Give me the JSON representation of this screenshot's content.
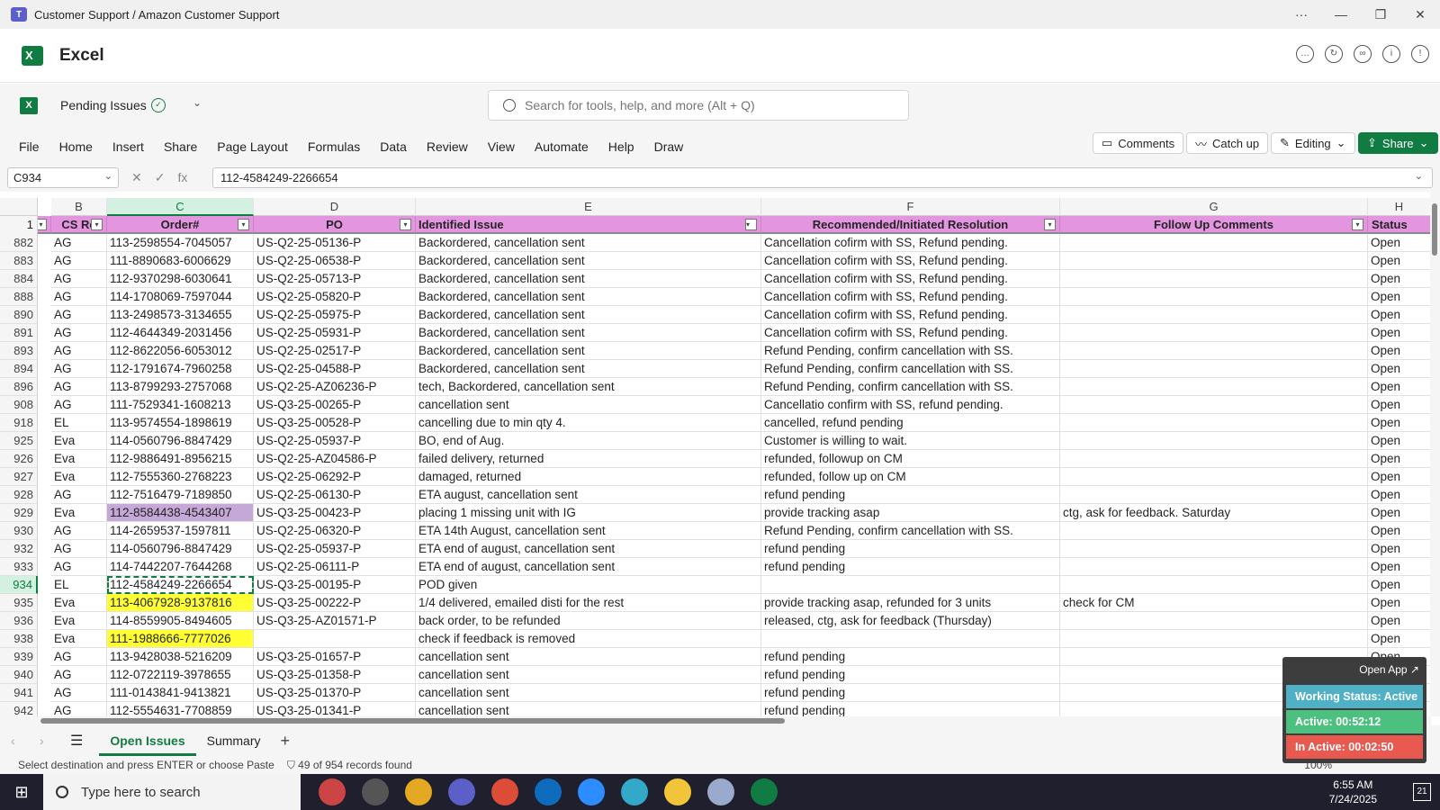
{
  "window": {
    "title": "Customer Support / Amazon Customer Support"
  },
  "app": {
    "name": "Excel"
  },
  "doc": {
    "name": "Pending Issues",
    "search_placeholder": "Search for tools, help, and more (Alt + Q)"
  },
  "ribbon": {
    "tabs": [
      "File",
      "Home",
      "Insert",
      "Share",
      "Page Layout",
      "Formulas",
      "Data",
      "Review",
      "View",
      "Automate",
      "Help",
      "Draw"
    ],
    "comments": "Comments",
    "catchup": "Catch up",
    "editing": "Editing",
    "share": "Share"
  },
  "formula": {
    "namebox": "C934",
    "value": "112-4584249-2266654"
  },
  "columns": [
    "B",
    "C",
    "D",
    "E",
    "F",
    "G",
    "H"
  ],
  "header_row_num": "1",
  "headers": [
    "CS Re",
    "Order#",
    "PO",
    "Identified Issue",
    "Recommended/Initiated Resolution",
    "Follow Up Comments",
    "Status"
  ],
  "rows": [
    {
      "n": "882",
      "b": "AG",
      "c": "113-2598554-7045057",
      "d": "US-Q2-25-05136-P",
      "e": "Backordered, cancellation sent",
      "f": "Cancellation cofirm with SS, Refund pending.",
      "g": "",
      "h": "Open"
    },
    {
      "n": "883",
      "b": "AG",
      "c": "111-8890683-6006629",
      "d": "US-Q2-25-06538-P",
      "e": "Backordered, cancellation sent",
      "f": "Cancellation cofirm with SS, Refund pending.",
      "g": "",
      "h": "Open"
    },
    {
      "n": "884",
      "b": "AG",
      "c": "112-9370298-6030641",
      "d": "US-Q2-25-05713-P",
      "e": "Backordered, cancellation sent",
      "f": "Cancellation cofirm with SS, Refund pending.",
      "g": "",
      "h": "Open"
    },
    {
      "n": "888",
      "b": "AG",
      "c": "114-1708069-7597044",
      "d": "US-Q2-25-05820-P",
      "e": "Backordered, cancellation sent",
      "f": "Cancellation cofirm with SS, Refund pending.",
      "g": "",
      "h": "Open"
    },
    {
      "n": "890",
      "b": "AG",
      "c": "113-2498573-3134655",
      "d": "US-Q2-25-05975-P",
      "e": "Backordered, cancellation sent",
      "f": "Cancellation cofirm with SS, Refund pending.",
      "g": "",
      "h": "Open"
    },
    {
      "n": "891",
      "b": "AG",
      "c": "112-4644349-2031456",
      "d": "US-Q2-25-05931-P",
      "e": "Backordered, cancellation sent",
      "f": "Cancellation cofirm with SS, Refund pending.",
      "g": "",
      "h": "Open"
    },
    {
      "n": "893",
      "b": "AG",
      "c": "112-8622056-6053012",
      "d": "US-Q2-25-02517-P",
      "e": "Backordered, cancellation sent",
      "f": "Refund Pending, confirm cancellation with SS.",
      "g": "",
      "h": "Open"
    },
    {
      "n": "894",
      "b": "AG",
      "c": "112-1791674-7960258",
      "d": "US-Q2-25-04588-P",
      "e": "Backordered, cancellation sent",
      "f": "Refund Pending, confirm cancellation with SS.",
      "g": "",
      "h": "Open"
    },
    {
      "n": "896",
      "b": "AG",
      "c": "113-8799293-2757068",
      "d": "US-Q2-25-AZ06236-P",
      "e": "tech, Backordered, cancellation sent",
      "f": "Refund Pending, confirm cancellation with SS.",
      "g": "",
      "h": "Open"
    },
    {
      "n": "908",
      "b": "AG",
      "c": "111-7529341-1608213",
      "d": "US-Q3-25-00265-P",
      "e": "cancellation sent",
      "f": "Cancellatio confirm with SS, refund pending.",
      "g": "",
      "h": "Open"
    },
    {
      "n": "918",
      "b": "EL",
      "c": "113-9574554-1898619",
      "d": "US-Q3-25-00528-P",
      "e": "cancelling due to min qty 4.",
      "f": "cancelled, refund pending",
      "g": "",
      "h": "Open"
    },
    {
      "n": "925",
      "b": "Eva",
      "c": "114-0560796-8847429",
      "d": "US-Q2-25-05937-P",
      "e": "BO, end of Aug.",
      "f": "Customer is willing to wait.",
      "g": "",
      "h": "Open"
    },
    {
      "n": "926",
      "b": "Eva",
      "c": "112-9886491-8956215",
      "d": "US-Q2-25-AZ04586-P",
      "e": "failed delivery, returned",
      "f": "refunded, followup on CM",
      "g": "",
      "h": "Open"
    },
    {
      "n": "927",
      "b": "Eva",
      "c": "112-7555360-2768223",
      "d": "US-Q2-25-06292-P",
      "e": "damaged, returned",
      "f": "refunded, follow up on CM",
      "g": "",
      "h": "Open"
    },
    {
      "n": "928",
      "b": "AG",
      "c": "112-7516479-7189850",
      "d": "US-Q2-25-06130-P",
      "e": "ETA august, cancellation sent",
      "f": "refund pending",
      "g": "",
      "h": "Open"
    },
    {
      "n": "929",
      "b": "Eva",
      "c": "112-8584438-4543407",
      "d": "US-Q3-25-00423-P",
      "e": "placing 1 missing unit with IG",
      "f": "provide tracking asap",
      "g": "ctg, ask for feedback. Saturday",
      "h": "Open",
      "hl": "purple"
    },
    {
      "n": "930",
      "b": "AG",
      "c": "114-2659537-1597811",
      "d": "US-Q2-25-06320-P",
      "e": "ETA 14th August, cancellation sent",
      "f": "Refund Pending, confirm cancellation with SS.",
      "g": "",
      "h": "Open"
    },
    {
      "n": "932",
      "b": "AG",
      "c": "114-0560796-8847429",
      "d": "US-Q2-25-05937-P",
      "e": "ETA end of august, cancellation sent",
      "f": "refund pending",
      "g": "",
      "h": "Open"
    },
    {
      "n": "933",
      "b": "AG",
      "c": "114-7442207-7644268",
      "d": "US-Q2-25-06111-P",
      "e": "ETA end of august, cancellation sent",
      "f": "refund pending",
      "g": "",
      "h": "Open"
    },
    {
      "n": "934",
      "b": "EL",
      "c": "112-4584249-2266654",
      "d": "US-Q3-25-00195-P",
      "e": "POD given",
      "f": "",
      "g": "",
      "h": "Open",
      "sel": true
    },
    {
      "n": "935",
      "b": "Eva",
      "c": "113-4067928-9137816",
      "d": "US-Q3-25-00222-P",
      "e": "1/4 delivered, emailed disti for the rest",
      "f": "provide tracking asap, refunded for 3 units",
      "g": "check for CM",
      "h": "Open",
      "hl": "yellow"
    },
    {
      "n": "936",
      "b": "Eva",
      "c": "114-8559905-8494605",
      "d": "US-Q3-25-AZ01571-P",
      "e": "back order, to be refunded",
      "f": "released, ctg, ask for feedback (Thursday)",
      "g": "",
      "h": "Open"
    },
    {
      "n": "938",
      "b": "Eva",
      "c": "111-1988666-7777026",
      "d": "",
      "e": "check if feedback is removed",
      "f": "",
      "g": "",
      "h": "Open",
      "hl": "yellow"
    },
    {
      "n": "939",
      "b": "AG",
      "c": "113-9428038-5216209",
      "d": "US-Q3-25-01657-P",
      "e": "cancellation sent",
      "f": "refund pending",
      "g": "",
      "h": "Open"
    },
    {
      "n": "940",
      "b": "AG",
      "c": "112-0722119-3978655",
      "d": "US-Q3-25-01358-P",
      "e": "cancellation sent",
      "f": "refund pending",
      "g": "",
      "h": "Open"
    },
    {
      "n": "941",
      "b": "AG",
      "c": "111-0143841-9413821",
      "d": "US-Q3-25-01370-P",
      "e": "cancellation sent",
      "f": "refund pending",
      "g": "",
      "h": "Open"
    },
    {
      "n": "942",
      "b": "AG",
      "c": "112-5554631-7708859",
      "d": "US-Q3-25-01341-P",
      "e": "cancellation sent",
      "f": "refund pending",
      "g": "",
      "h": "Open"
    }
  ],
  "sheets": [
    "Open Issues",
    "Summary"
  ],
  "status": {
    "message": "Select destination and press ENTER or choose Paste",
    "filter": "49 of 954 records found",
    "zoom": "100%"
  },
  "widget": {
    "open_app": "Open App ↗",
    "working": "Working Status: Active",
    "active": "Active: 00:52:12",
    "inactive": "In Active: 00:02:50"
  },
  "taskbar": {
    "search": "Type here to search",
    "time": "6:55 AM",
    "date": "7/24/2025",
    "notif": "21"
  }
}
